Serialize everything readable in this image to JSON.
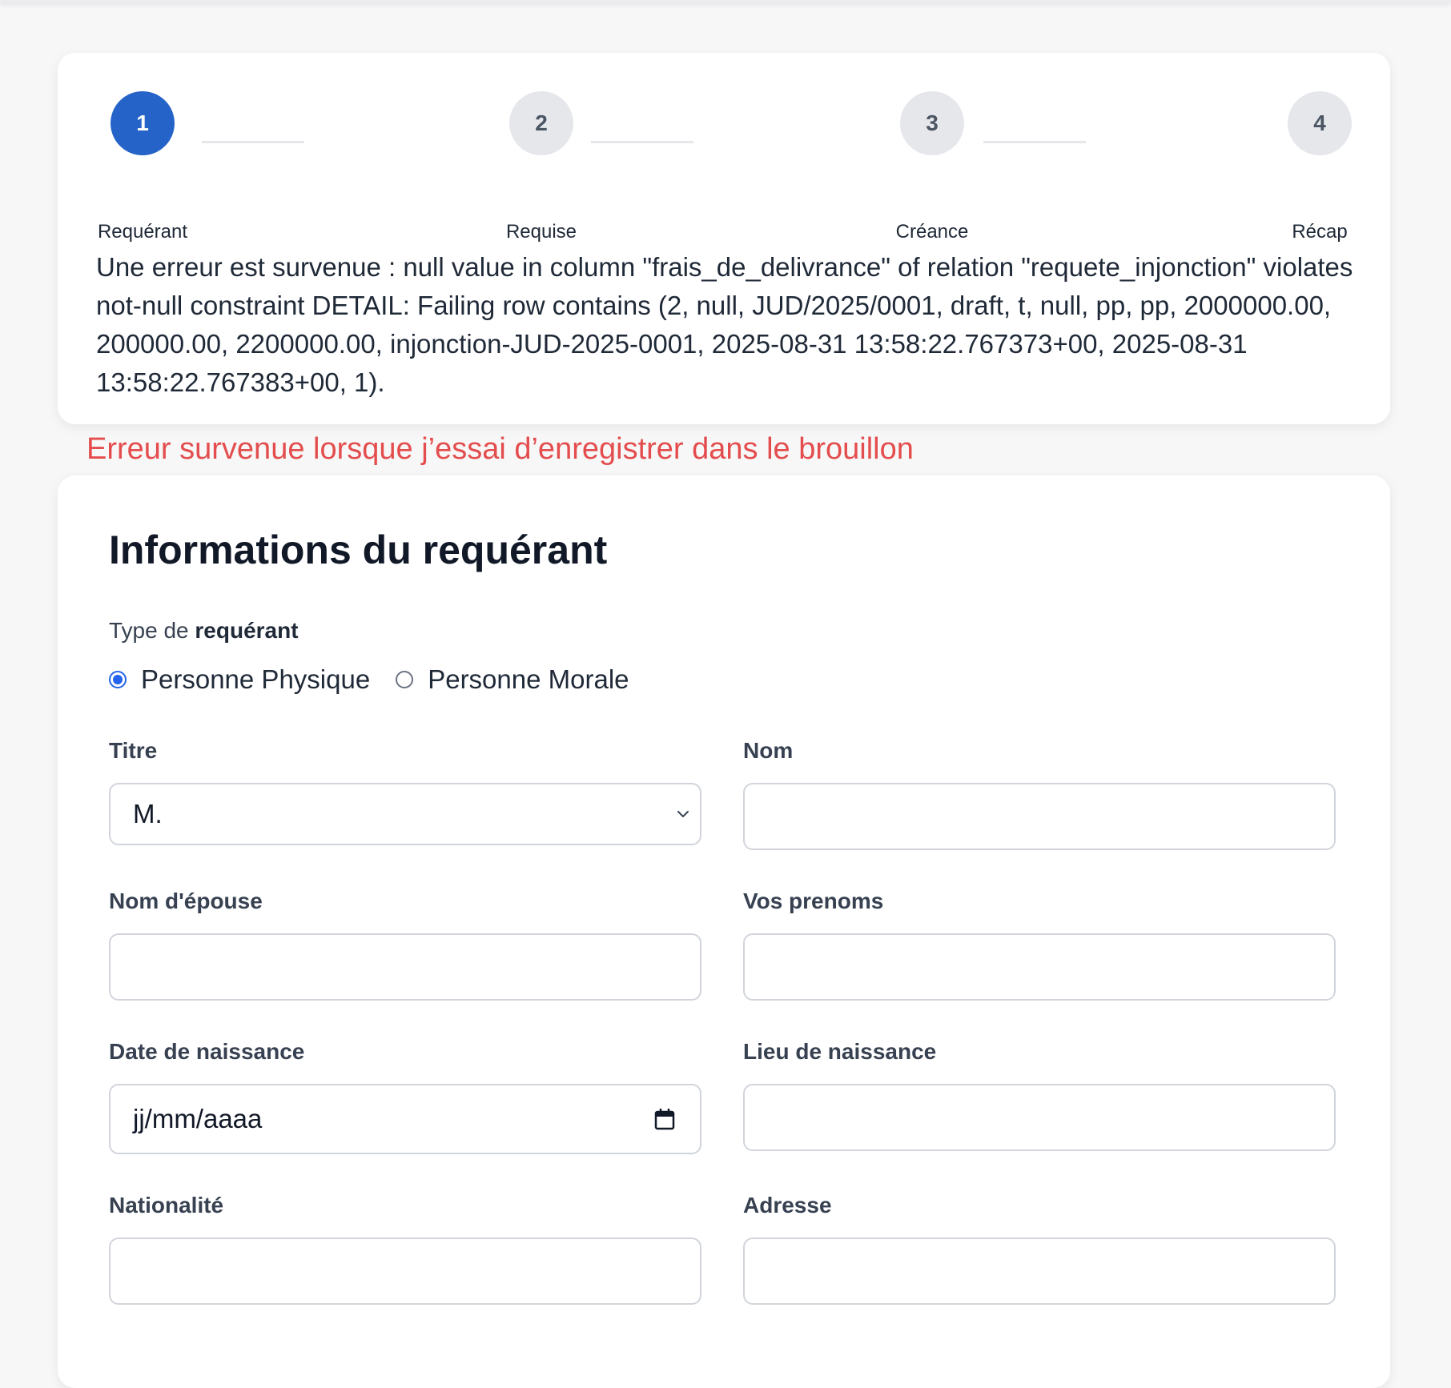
{
  "stepper": {
    "steps": [
      {
        "number": "1",
        "label": "Requérant",
        "active": true
      },
      {
        "number": "2",
        "label": "Requise",
        "active": false
      },
      {
        "number": "3",
        "label": "Créance",
        "active": false
      },
      {
        "number": "4",
        "label": "Récap",
        "active": false
      }
    ]
  },
  "error": {
    "message": "Une erreur est survenue : null value in column \"frais_de_delivrance\" of relation \"requete_injonction\" violates not-null constraint DETAIL: Failing row contains (2, null, JUD/2025/0001, draft, t, null, pp, pp, 2000000.00, 200000.00, 2200000.00, injonction-JUD-2025-0001, 2025-08-31 13:58:22.767373+00, 2025-08-31 13:58:22.767383+00, 1).",
    "annotation": "Erreur survenue lorsque j’essai d’enregistrer dans le brouillon",
    "annotation_color": "#e44d4d"
  },
  "form": {
    "title": "Informations du requérant",
    "type_label_prefix": "Type de ",
    "type_label_bold": "requérant",
    "radio_options": [
      "Personne Physique",
      "Personne Morale"
    ],
    "radio_selected": "Personne Physique",
    "fields": {
      "titre_label": "Titre",
      "titre_value": "M.",
      "nom_label": "Nom",
      "nom_value": "",
      "nom_epouse_label": "Nom d'épouse",
      "nom_epouse_value": "",
      "prenoms_label": "Vos prenoms",
      "prenoms_value": "",
      "date_naissance_label": "Date de naissance",
      "date_naissance_placeholder": "jj/mm/aaaa",
      "lieu_naissance_label": "Lieu de naissance",
      "lieu_naissance_value": "",
      "nationalite_label": "Nationalité",
      "nationalite_value": "",
      "adresse_label": "Adresse",
      "adresse_value": ""
    }
  },
  "colors": {
    "accent": "#2563c8",
    "radio_accent": "#2563eb",
    "page_bg": "#f7f7f8"
  }
}
